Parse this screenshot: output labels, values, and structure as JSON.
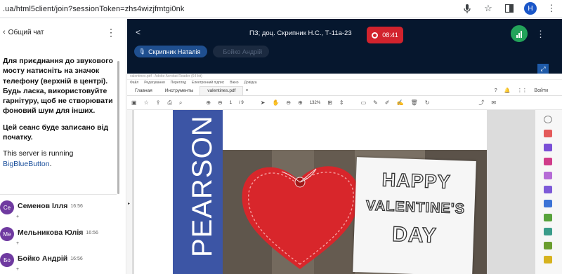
{
  "browser": {
    "url": ".ua/html5client/join?sessionToken=zhs4wizjfmtgi0nk",
    "profile_initial": "H"
  },
  "chat": {
    "title": "Общий чат",
    "welcome_bold": "Для приєднання до звукового мосту натисніть на значок телефону (верхній в центрі). Будь ласка, використовуйте гарнітуру, щоб не створювати фоновий шум для інших.",
    "record_notice": "Цей сеанс буде записано від початку.",
    "server_text": "This server is running",
    "server_link": "BigBlueButton",
    "server_suffix": ".",
    "messages": [
      {
        "initials": "Се",
        "name": "Семенов Ілля",
        "time": "16:56",
        "text": "+"
      },
      {
        "initials": "Ме",
        "name": "Мельникова Юлія",
        "time": "16:56",
        "text": "+"
      },
      {
        "initials": "Бо",
        "name": "Бойко Андрій",
        "time": "16:56",
        "text": "+"
      }
    ]
  },
  "meeting": {
    "title": "ПЗ; доц. Скрипник Н.С., Т-11а-23",
    "recording_time": "08:41",
    "talkers": [
      {
        "name": "Скрипник Наталія",
        "active": true
      },
      {
        "name": "Бойко Андрій",
        "active": false
      }
    ]
  },
  "presentation": {
    "app_title": "valentines.pdf - Adobe Acrobat Reader (64-bit)",
    "menu": [
      "Файл",
      "Редагування",
      "Перегляд",
      "Електронний підпис",
      "Вікно",
      "Довідка"
    ],
    "tabs": [
      "Главная",
      "Инструменты",
      "valentines.pdf"
    ],
    "signin": "Войти",
    "page_num": "1",
    "page_total": "/ 9",
    "zoom": "132%",
    "publisher": "PEARSON",
    "card_line1": "HAPPY",
    "card_line2": "VALENTINE'S",
    "card_line3": "DAY"
  },
  "colors": {
    "conference_bg": "#06172e",
    "recording_red": "#d2232d",
    "signal_green": "#23a35a",
    "pearson_blue": "#3c55a5",
    "heart_red": "#d8262b"
  }
}
